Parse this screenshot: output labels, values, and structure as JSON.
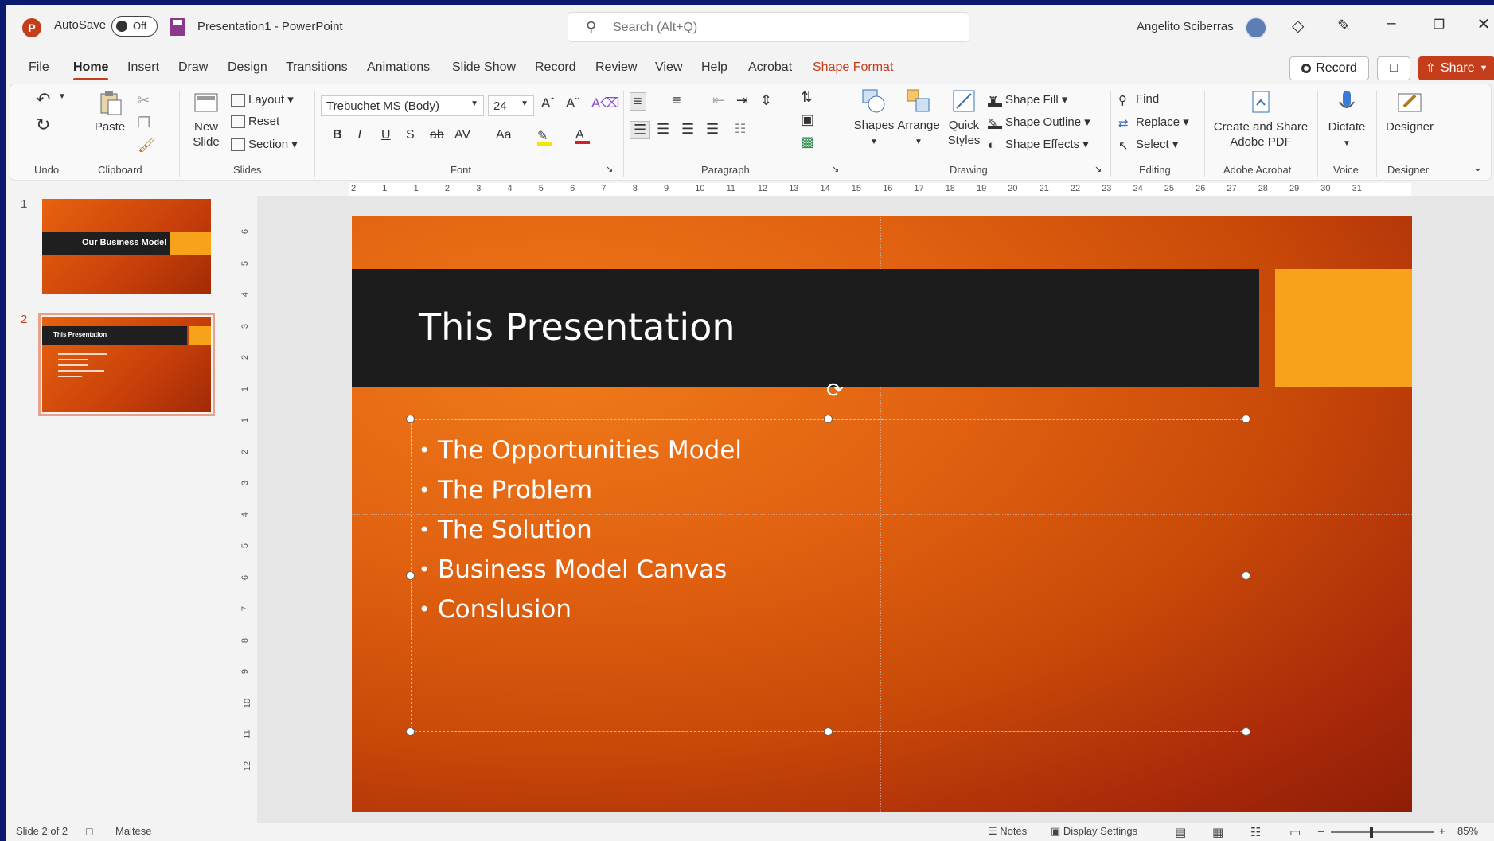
{
  "titlebar": {
    "app_logo": "P",
    "autosave_label": "AutoSave",
    "autosave_state": "Off",
    "document_title": "Presentation1  -  PowerPoint",
    "search_placeholder": "Search (Alt+Q)",
    "user_name": "Angelito Sciberras"
  },
  "menu": {
    "tabs": [
      "File",
      "Home",
      "Insert",
      "Draw",
      "Design",
      "Transitions",
      "Animations",
      "Slide Show",
      "Record",
      "Review",
      "View",
      "Help",
      "Acrobat",
      "Shape Format"
    ],
    "active_tab": "Home",
    "record_label": "Record",
    "share_label": "Share"
  },
  "ribbon": {
    "groups": {
      "undo": "Undo",
      "clipboard": "Clipboard",
      "slides": "Slides",
      "font": "Font",
      "paragraph": "Paragraph",
      "drawing": "Drawing",
      "editing": "Editing",
      "adobe": "Adobe Acrobat",
      "voice": "Voice",
      "designer": "Designer"
    },
    "paste": "Paste",
    "new_slide_1": "New",
    "new_slide_2": "Slide",
    "layout": "Layout",
    "reset": "Reset",
    "section": "Section",
    "font_name": "Trebuchet MS (Body)",
    "font_size": "24",
    "bold": "B",
    "italic": "I",
    "underline": "U",
    "shadow": "S",
    "strike": "ab",
    "spacing": "AV",
    "case": "Aa",
    "shapes": "Shapes",
    "arrange": "Arrange",
    "quick_styles_1": "Quick",
    "quick_styles_2": "Styles",
    "shape_fill": "Shape Fill",
    "shape_outline": "Shape Outline",
    "shape_effects": "Shape Effects",
    "find": "Find",
    "replace": "Replace",
    "select": "Select",
    "create_share_1": "Create and Share",
    "create_share_2": "Adobe PDF",
    "dictate": "Dictate",
    "designer": "Designer"
  },
  "thumbnails": [
    {
      "number": "1",
      "title": "Our Business Model"
    },
    {
      "number": "2",
      "title": "This Presentation"
    }
  ],
  "ruler": {
    "h_ticks": [
      "2",
      "1",
      "1",
      "2",
      "3",
      "4",
      "5",
      "6",
      "7",
      "8",
      "9",
      "10",
      "11",
      "12",
      "13",
      "14",
      "15",
      "16",
      "17",
      "18",
      "19",
      "20",
      "21",
      "22",
      "23",
      "24",
      "25",
      "26",
      "27",
      "28",
      "29",
      "30",
      "31"
    ],
    "v_ticks": [
      "6",
      "5",
      "4",
      "3",
      "2",
      "1",
      "1",
      "2",
      "3",
      "4",
      "5",
      "6",
      "7",
      "8",
      "9",
      "10",
      "11",
      "12"
    ]
  },
  "slide": {
    "title": "This Presentation",
    "bullets": [
      "The Opportunities Model",
      "The Problem",
      "The Solution",
      "Business Model Canvas",
      "Conslusion"
    ]
  },
  "status": {
    "slide_indicator": "Slide 2 of 2",
    "language": "Maltese",
    "notes": "Notes",
    "display_settings": "Display Settings",
    "zoom": "85%"
  },
  "colors": {
    "accent": "#c43e1c",
    "title_band": "#1c1c1c",
    "accent_block": "#f6a21a"
  }
}
